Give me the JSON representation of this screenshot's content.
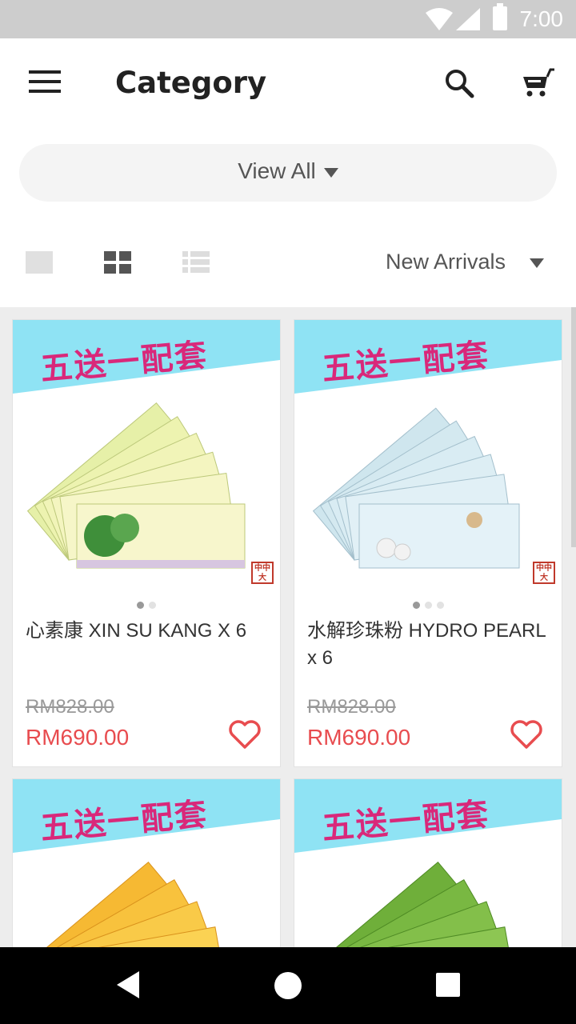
{
  "status_bar": {
    "time": "7:00",
    "wifi_icon": "wifi-icon",
    "signal_icon": "signal-icon",
    "battery_icon": "battery-icon"
  },
  "app_bar": {
    "title": "Category",
    "menu_icon": "hamburger-menu-icon",
    "search_icon": "search-icon",
    "cart_icon": "cart-icon"
  },
  "filter": {
    "label": "View All"
  },
  "sort": {
    "label": "New Arrivals"
  },
  "view_modes": [
    "single-view-icon",
    "grid-view-icon",
    "list-view-icon"
  ],
  "colors": {
    "price_red": "#e84c4f",
    "banner_cyan": "#86dff2",
    "banner_text": "#d9287a"
  },
  "products": [
    {
      "banner": "五送一配套",
      "seal": "中中 大",
      "name": "心素康 XIN SU KANG X 6",
      "old_price": "RM828.00",
      "price": "RM690.00",
      "dots": 2,
      "active_dot": 0,
      "theme": "yellow"
    },
    {
      "banner": "五送一配套",
      "seal": "中中 大",
      "name": "水解珍珠粉 HYDRO PEARL x 6",
      "old_price": "RM828.00",
      "price": "RM690.00",
      "dots": 3,
      "active_dot": 0,
      "theme": "blue"
    },
    {
      "banner": "五送一配套",
      "theme": "orange"
    },
    {
      "banner": "五送一配套",
      "theme": "green"
    }
  ],
  "nav_bar": {
    "back_icon": "back-icon",
    "home_icon": "home-icon",
    "recents_icon": "recents-icon"
  }
}
